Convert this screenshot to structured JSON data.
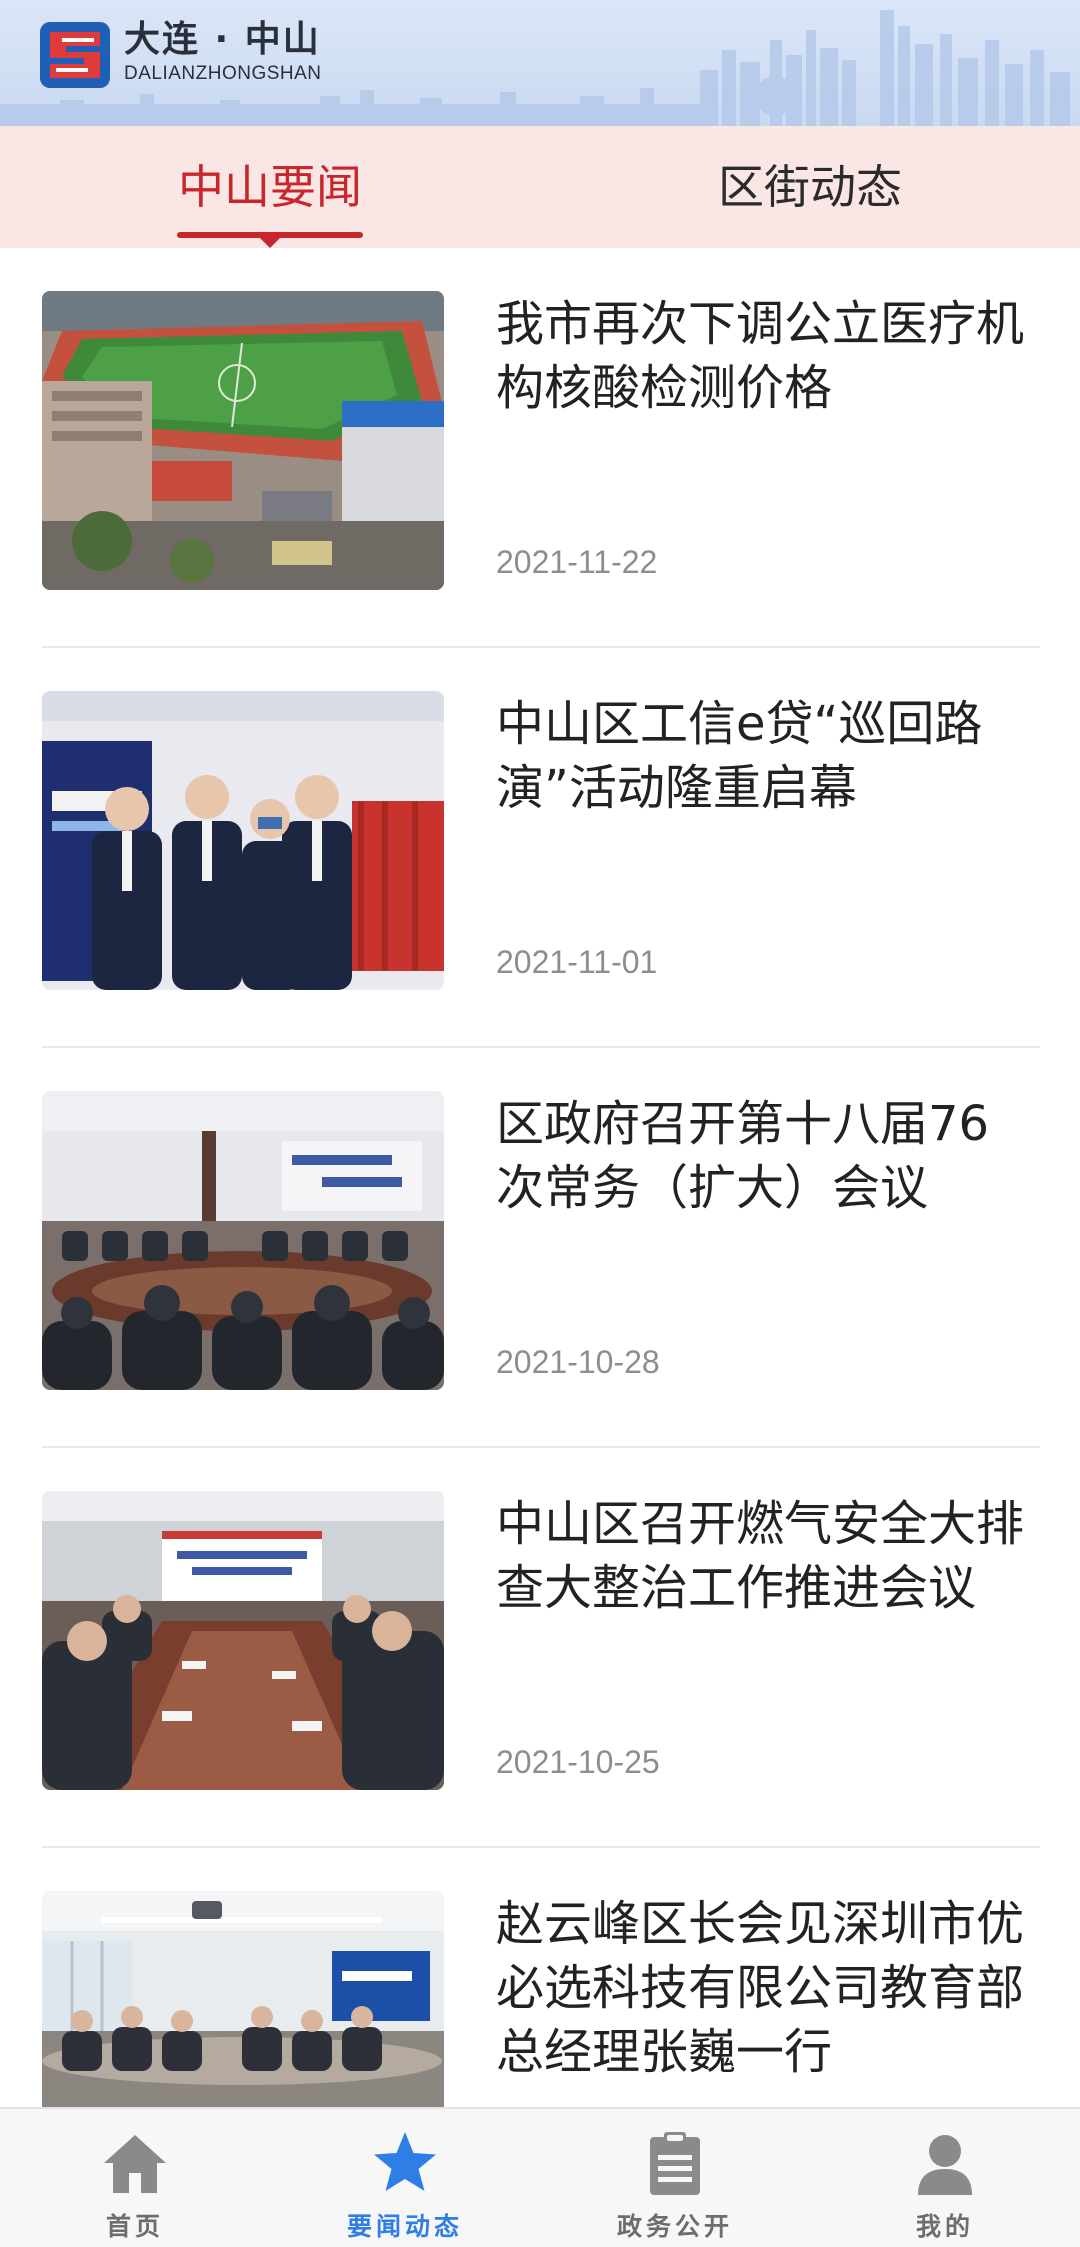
{
  "header": {
    "brand_cn": "大连 · 中山",
    "brand_en": "DALIANZHONGSHAN",
    "logo_letter": "G"
  },
  "tabs": [
    {
      "label": "中山要闻",
      "active": true
    },
    {
      "label": "区街动态",
      "active": false
    }
  ],
  "news": [
    {
      "title": "我市再次下调公立医疗机构核酸检测价格",
      "date": "2021-11-22"
    },
    {
      "title": "中山区工信e贷“巡回路演”活动隆重启幕",
      "date": "2021-11-01"
    },
    {
      "title": "区政府召开第十八届76次常务（扩大）会议",
      "date": "2021-10-28"
    },
    {
      "title": "中山区召开燃气安全大排查大整治工作推进会议",
      "date": "2021-10-25"
    },
    {
      "title": "赵云峰区长会见深圳市优必选科技有限公司教育部总经理张巍一行",
      "date": ""
    }
  ],
  "bottom_nav": [
    {
      "label": "首页",
      "icon": "home-icon",
      "active": false
    },
    {
      "label": "要闻动态",
      "icon": "star-icon",
      "active": true
    },
    {
      "label": "政务公开",
      "icon": "clipboard-icon",
      "active": false
    },
    {
      "label": "我的",
      "icon": "user-icon",
      "active": false
    }
  ],
  "colors": {
    "accent_red": "#c8262b",
    "nav_active_blue": "#2f7ee6",
    "tab_bar_bg": "#fbe6e6",
    "header_bg": "#d3e0f5"
  }
}
